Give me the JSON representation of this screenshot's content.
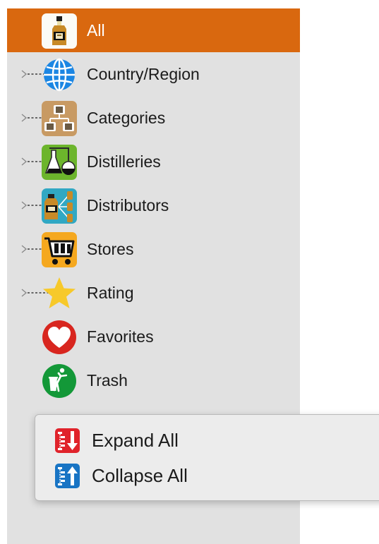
{
  "sidebar": {
    "items": [
      {
        "label": "All",
        "icon": "bottle-icon",
        "selected": true
      },
      {
        "label": "Country/Region",
        "icon": "globe-icon",
        "expandable": true
      },
      {
        "label": "Categories",
        "icon": "categories-hierarchy-icon",
        "expandable": true
      },
      {
        "label": "Distilleries",
        "icon": "flask-icon",
        "expandable": true
      },
      {
        "label": "Distributors",
        "icon": "distributors-icon",
        "expandable": true
      },
      {
        "label": "Stores",
        "icon": "shopping-cart-icon",
        "expandable": true
      },
      {
        "label": "Rating",
        "icon": "star-icon",
        "expandable": true
      },
      {
        "label": "Favorites",
        "icon": "heart-icon"
      },
      {
        "label": "Trash",
        "icon": "trash-icon"
      }
    ]
  },
  "context_menu": {
    "items": [
      {
        "label": "Expand All",
        "icon": "expand-all-icon"
      },
      {
        "label": "Collapse All",
        "icon": "collapse-all-icon"
      }
    ]
  },
  "colors": {
    "selection": "#d9680f",
    "sidebar_bg": "#e1e1e1",
    "menu_bg": "#ececec"
  }
}
